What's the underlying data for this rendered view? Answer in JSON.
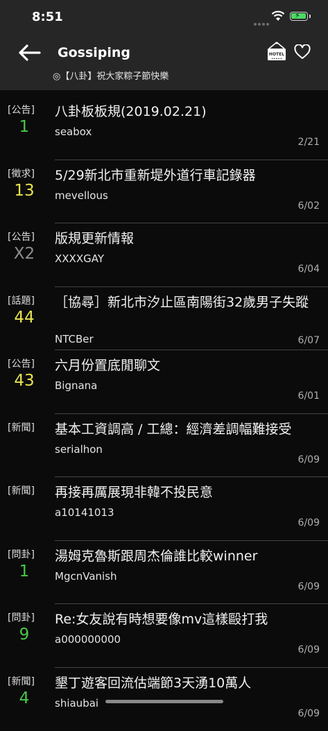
{
  "status": {
    "time": "8:51"
  },
  "header": {
    "title": "Gossiping",
    "subtitle": "◎【八卦】祝大家粽子節快樂",
    "hotel_icon_text": "HOTEL"
  },
  "posts": [
    {
      "category": "[公告]",
      "count": "1",
      "count_color": "green",
      "title": "八卦板板規(2019.02.21)",
      "author": "seabox",
      "date": "2/21"
    },
    {
      "category": "[徵求]",
      "count": "13",
      "count_color": "yellow",
      "title": "5/29新北市重新堤外道行車記錄器",
      "author": "mevellous",
      "date": "6/02"
    },
    {
      "category": "[公告]",
      "count": "X2",
      "count_color": "gray",
      "title": "版規更新情報",
      "author": "XXXXGAY",
      "date": "6/04"
    },
    {
      "category": "[話題]",
      "count": "44",
      "count_color": "yellow",
      "title": "［協尋］新北市汐止區南陽街32歲男子失蹤",
      "author": "NTCBer",
      "date": "6/07"
    },
    {
      "category": "[公告]",
      "count": "43",
      "count_color": "yellow",
      "title": "六月份置底閒聊文",
      "author": "Bignana",
      "date": "6/01"
    },
    {
      "category": "[新聞]",
      "count": "",
      "count_color": "green",
      "title": "基本工資調高 / 工總：經濟差調幅難接受",
      "author": "serialhon",
      "date": "6/09"
    },
    {
      "category": "[新聞]",
      "count": "",
      "count_color": "green",
      "title": "再接再厲展現非韓不投民意",
      "author": "a10141013",
      "date": "6/09"
    },
    {
      "category": "[問卦]",
      "count": "1",
      "count_color": "green",
      "title": "湯姆克魯斯跟周杰倫誰比較winner",
      "author": "MgcnVanish",
      "date": "6/09"
    },
    {
      "category": "[問卦]",
      "count": "9",
      "count_color": "green",
      "title": "Re:女友說有時想要像mv這樣毆打我",
      "author": "a000000000",
      "date": "6/09"
    },
    {
      "category": "[新聞]",
      "count": "4",
      "count_color": "green",
      "title": "墾丁遊客回流估端節3天湧10萬人",
      "author": "shiaubai",
      "date": "6/09"
    }
  ],
  "colors": {
    "green": "#48c948",
    "yellow": "#e8e34f",
    "gray": "#8e8e8e",
    "bar": "#262626"
  }
}
